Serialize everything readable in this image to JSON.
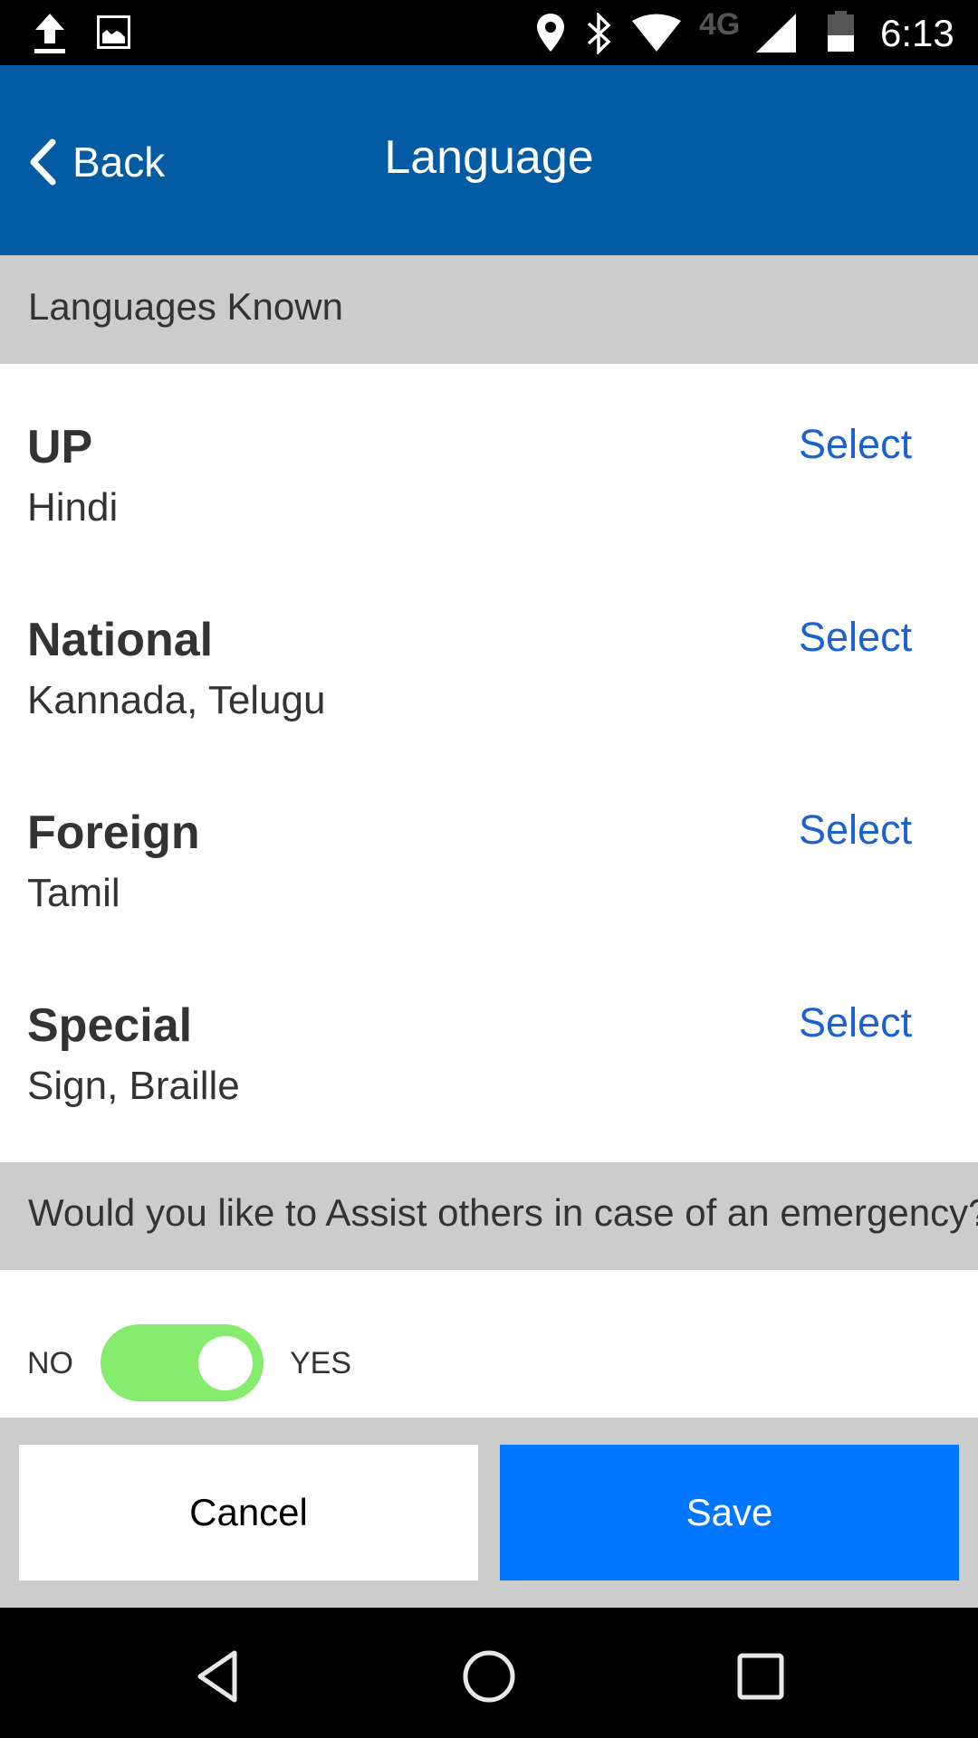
{
  "status_bar": {
    "time": "6:13",
    "network_type": "4G",
    "left_icons": [
      "upload-icon",
      "image-icon"
    ],
    "right_icons": [
      "location-icon",
      "bluetooth-icon",
      "wifi-icon",
      "network-4g",
      "signal-icon",
      "battery-icon"
    ]
  },
  "header": {
    "back_label": "Back",
    "title": "Language"
  },
  "languages_section": {
    "title": "Languages Known",
    "rows": [
      {
        "category": "UP",
        "value": "Hindi",
        "action": "Select"
      },
      {
        "category": "National",
        "value": "Kannada, Telugu",
        "action": "Select"
      },
      {
        "category": "Foreign",
        "value": "Tamil",
        "action": "Select"
      },
      {
        "category": "Special",
        "value": "Sign, Braille",
        "action": "Select"
      }
    ]
  },
  "assist_section": {
    "question": "Would you like to Assist others in case of an emergency?",
    "no_label": "NO",
    "yes_label": "YES",
    "toggle_on": true,
    "toggle_color": "#86ec6e"
  },
  "actions": {
    "cancel_label": "Cancel",
    "save_label": "Save",
    "save_color": "#0077fe"
  },
  "colors": {
    "header": "#035ca3",
    "section_bg": "#cccccc",
    "link": "#1a62d0"
  },
  "nav_bar": {
    "buttons": [
      "back",
      "home",
      "recents"
    ]
  }
}
